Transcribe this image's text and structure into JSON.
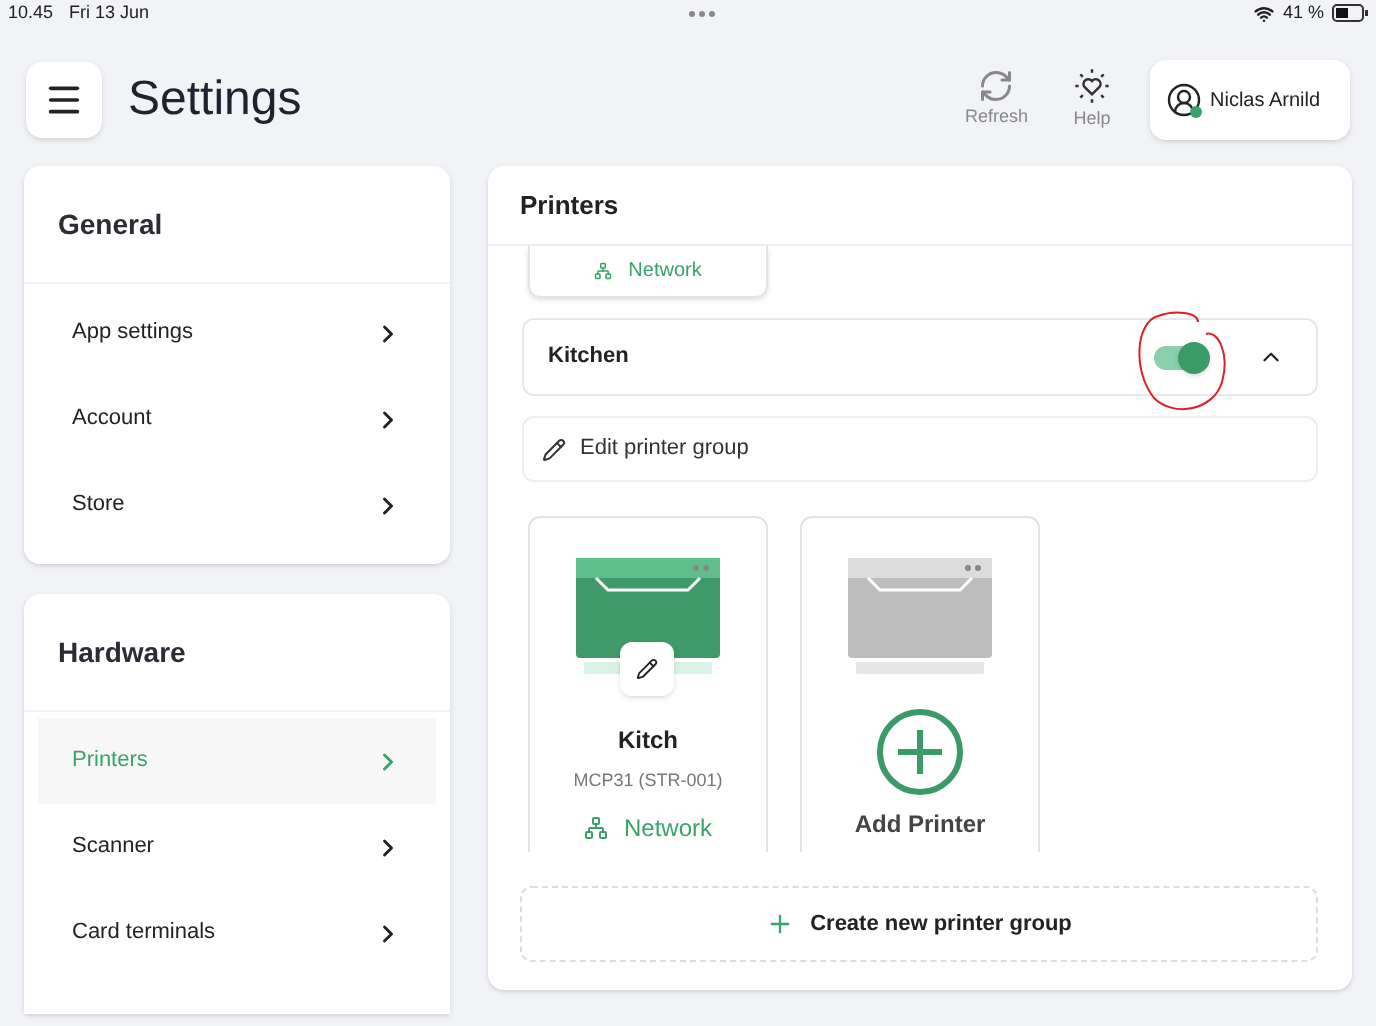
{
  "status_bar": {
    "time": "10.45",
    "date": "Fri 13 Jun",
    "battery": "41 %"
  },
  "header": {
    "title": "Settings",
    "actions": [
      {
        "label": "Refresh",
        "kind": "refresh"
      },
      {
        "label": "Help",
        "kind": "help"
      }
    ],
    "user": {
      "name": "Niclas Arnild",
      "online": true
    }
  },
  "sidebar": [
    {
      "title": "General",
      "items": [
        {
          "label": "App settings",
          "selected": false
        },
        {
          "label": "Account",
          "selected": false
        },
        {
          "label": "Store",
          "selected": false
        }
      ]
    },
    {
      "title": "Hardware",
      "items": [
        {
          "label": "Printers",
          "selected": true
        },
        {
          "label": "Scanner",
          "selected": false
        },
        {
          "label": "Card terminals",
          "selected": false
        }
      ]
    }
  ],
  "printers": {
    "title": "Printers",
    "previous_connection": "Network",
    "group": {
      "name": "Kitchen",
      "on": true,
      "expanded": true,
      "edit_label": "Edit printer group",
      "printers": [
        {
          "name": "Kitch",
          "model": "MCP31 (STR-001)",
          "connection": "Network"
        }
      ],
      "add_label": "Add Printer"
    },
    "create_label": "Create new printer group"
  }
}
